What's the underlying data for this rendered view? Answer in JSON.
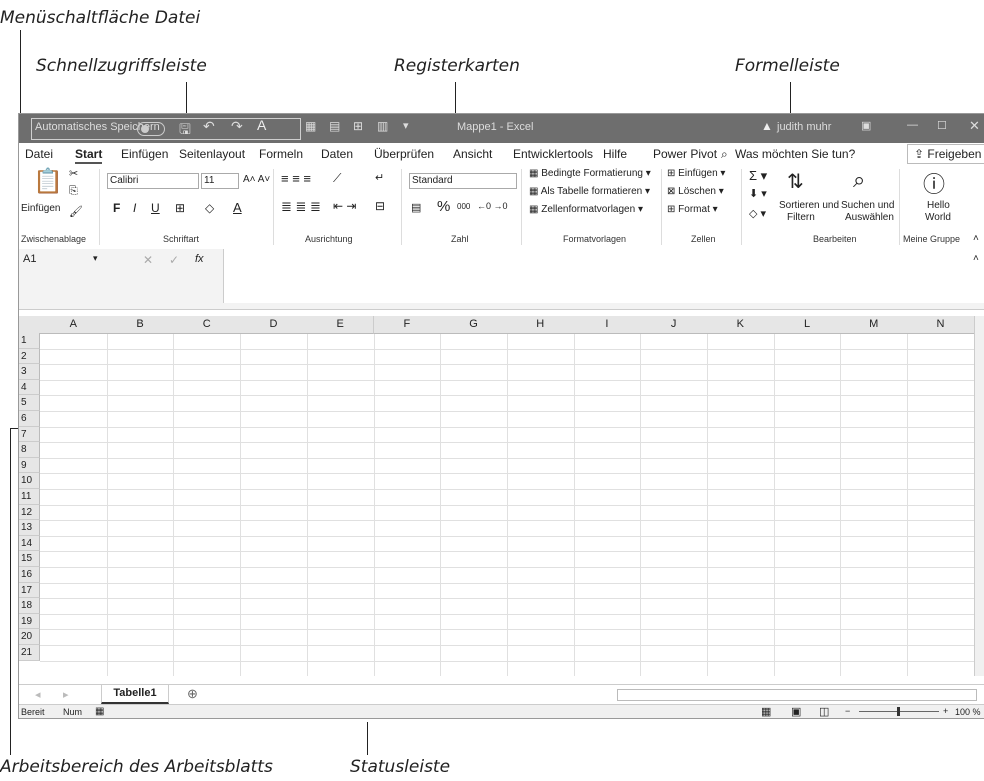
{
  "callouts": {
    "menu_button": "Menüschaltfläche Datei",
    "quick_access": "Schnellzugriffsleiste",
    "tabs": "Registerkarten",
    "formula_bar": "Formelleiste",
    "worksheet": "Arbeitsbereich des Arbeitsblatts",
    "statusbar": "Statusleiste"
  },
  "titlebar": {
    "autosave": "Automatisches Speichern",
    "title": "Mappe1 - Excel",
    "user": "judith muhr"
  },
  "tabs": [
    "Datei",
    "Start",
    "Einfügen",
    "Seitenlayout",
    "Formeln",
    "Daten",
    "Überprüfen",
    "Ansicht",
    "Entwicklertools",
    "Hilfe",
    "Power Pivot"
  ],
  "tell_me": "Was möchten Sie tun?",
  "share": "Freigeben",
  "ribbon": {
    "paste": "Einfügen",
    "font_name": "Calibri",
    "font_size": "11",
    "bold": "F",
    "italic": "I",
    "underline": "U",
    "number_format": "Standard",
    "percent": "%",
    "thousands": "000",
    "cond_format": "Bedingte Formatierung",
    "as_table": "Als Tabelle formatieren",
    "cell_styles": "Zellenformatvorlagen",
    "insert": "Einfügen",
    "delete": "Löschen",
    "format": "Format",
    "sort_filter_1": "Sortieren und",
    "sort_filter_2": "Filtern",
    "find_select_1": "Suchen und",
    "find_select_2": "Auswählen",
    "hello_1": "Hello",
    "hello_2": "World",
    "groups": {
      "clipboard": "Zwischenablage",
      "font": "Schriftart",
      "alignment": "Ausrichtung",
      "number": "Zahl",
      "styles": "Formatvorlagen",
      "cells": "Zellen",
      "editing": "Bearbeiten",
      "custom": "Meine Gruppe"
    }
  },
  "formula": {
    "name_box": "A1",
    "fx": "fx"
  },
  "columns": [
    "A",
    "B",
    "C",
    "D",
    "E",
    "F",
    "G",
    "H",
    "I",
    "J",
    "K",
    "L",
    "M",
    "N"
  ],
  "rows": [
    "1",
    "2",
    "3",
    "4",
    "5",
    "6",
    "7",
    "8",
    "9",
    "10",
    "11",
    "12",
    "13",
    "14",
    "15",
    "16",
    "17",
    "18",
    "19",
    "20",
    "21"
  ],
  "sheet_tab": "Tabelle1",
  "status": {
    "ready": "Bereit",
    "num": "Num",
    "zoom": "100 %"
  }
}
